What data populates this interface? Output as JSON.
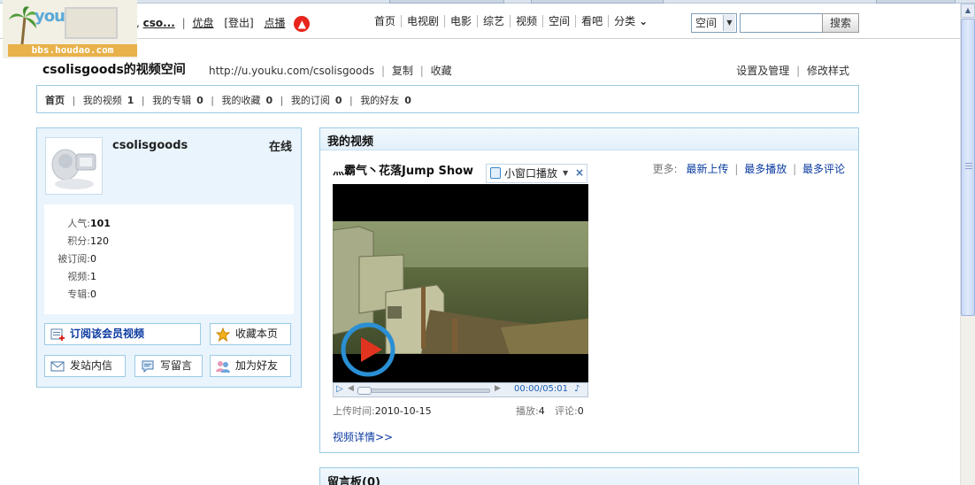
{
  "header": {
    "logo_text": "youku优酷",
    "logo_url": "bbs.houdao.com",
    "greeting": "hi,",
    "username_short": "cso...",
    "links": [
      "优盘",
      "[登出]",
      "点播"
    ]
  },
  "mainnav": {
    "items": [
      "首页",
      "电视剧",
      "电影",
      "综艺",
      "视频",
      "空间",
      "看吧",
      "分类"
    ],
    "search_scope": "空间",
    "search_button": "搜索"
  },
  "space": {
    "title": "csolisgoods的视频空间",
    "url": "http://u.youku.com/csolisgoods",
    "copy_label": "复制",
    "favorite_label": "收藏",
    "settings_label": "设置及管理",
    "style_label": "修改样式"
  },
  "subnav": {
    "home": "首页",
    "items": [
      {
        "label": "我的视频",
        "count": "1"
      },
      {
        "label": "我的专辑",
        "count": "0"
      },
      {
        "label": "我的收藏",
        "count": "0"
      },
      {
        "label": "我的订阅",
        "count": "0"
      },
      {
        "label": "我的好友",
        "count": "0"
      }
    ]
  },
  "profile": {
    "name": "csolisgoods",
    "status": "在线",
    "stats": [
      {
        "label": "人气:",
        "value": "101"
      },
      {
        "label": "积分:",
        "value": "120"
      },
      {
        "label": "被订阅:",
        "value": "0"
      },
      {
        "label": "视频:",
        "value": "1"
      },
      {
        "label": "专辑:",
        "value": "0"
      }
    ],
    "actions": {
      "subscribe": "订阅该会员视频",
      "bookmark": "收藏本页",
      "message": "发站内信",
      "comment": "写留言",
      "add_friend": "加为好友"
    }
  },
  "videos": {
    "panel_title": "我的视频",
    "video_title": "灬霸气丶花落Jump Show",
    "mini_play_label": "小窗口播放",
    "more_label": "更多:",
    "more_links": [
      "最新上传",
      "最多播放",
      "最多评论"
    ],
    "time": "00:00/05:01",
    "upload_label": "上传时间:",
    "upload_date": "2010-10-15",
    "plays_label": "播放:",
    "plays": "4",
    "comments_label": "评论:",
    "comments": "0",
    "detail_link": "视频详情>>"
  },
  "guestbook": {
    "title": "留言板(0)"
  },
  "colors": {
    "panel_border": "#9ccbe6",
    "panel_bg": "#e9f4fc",
    "link_blue": "#0a3aa0"
  }
}
